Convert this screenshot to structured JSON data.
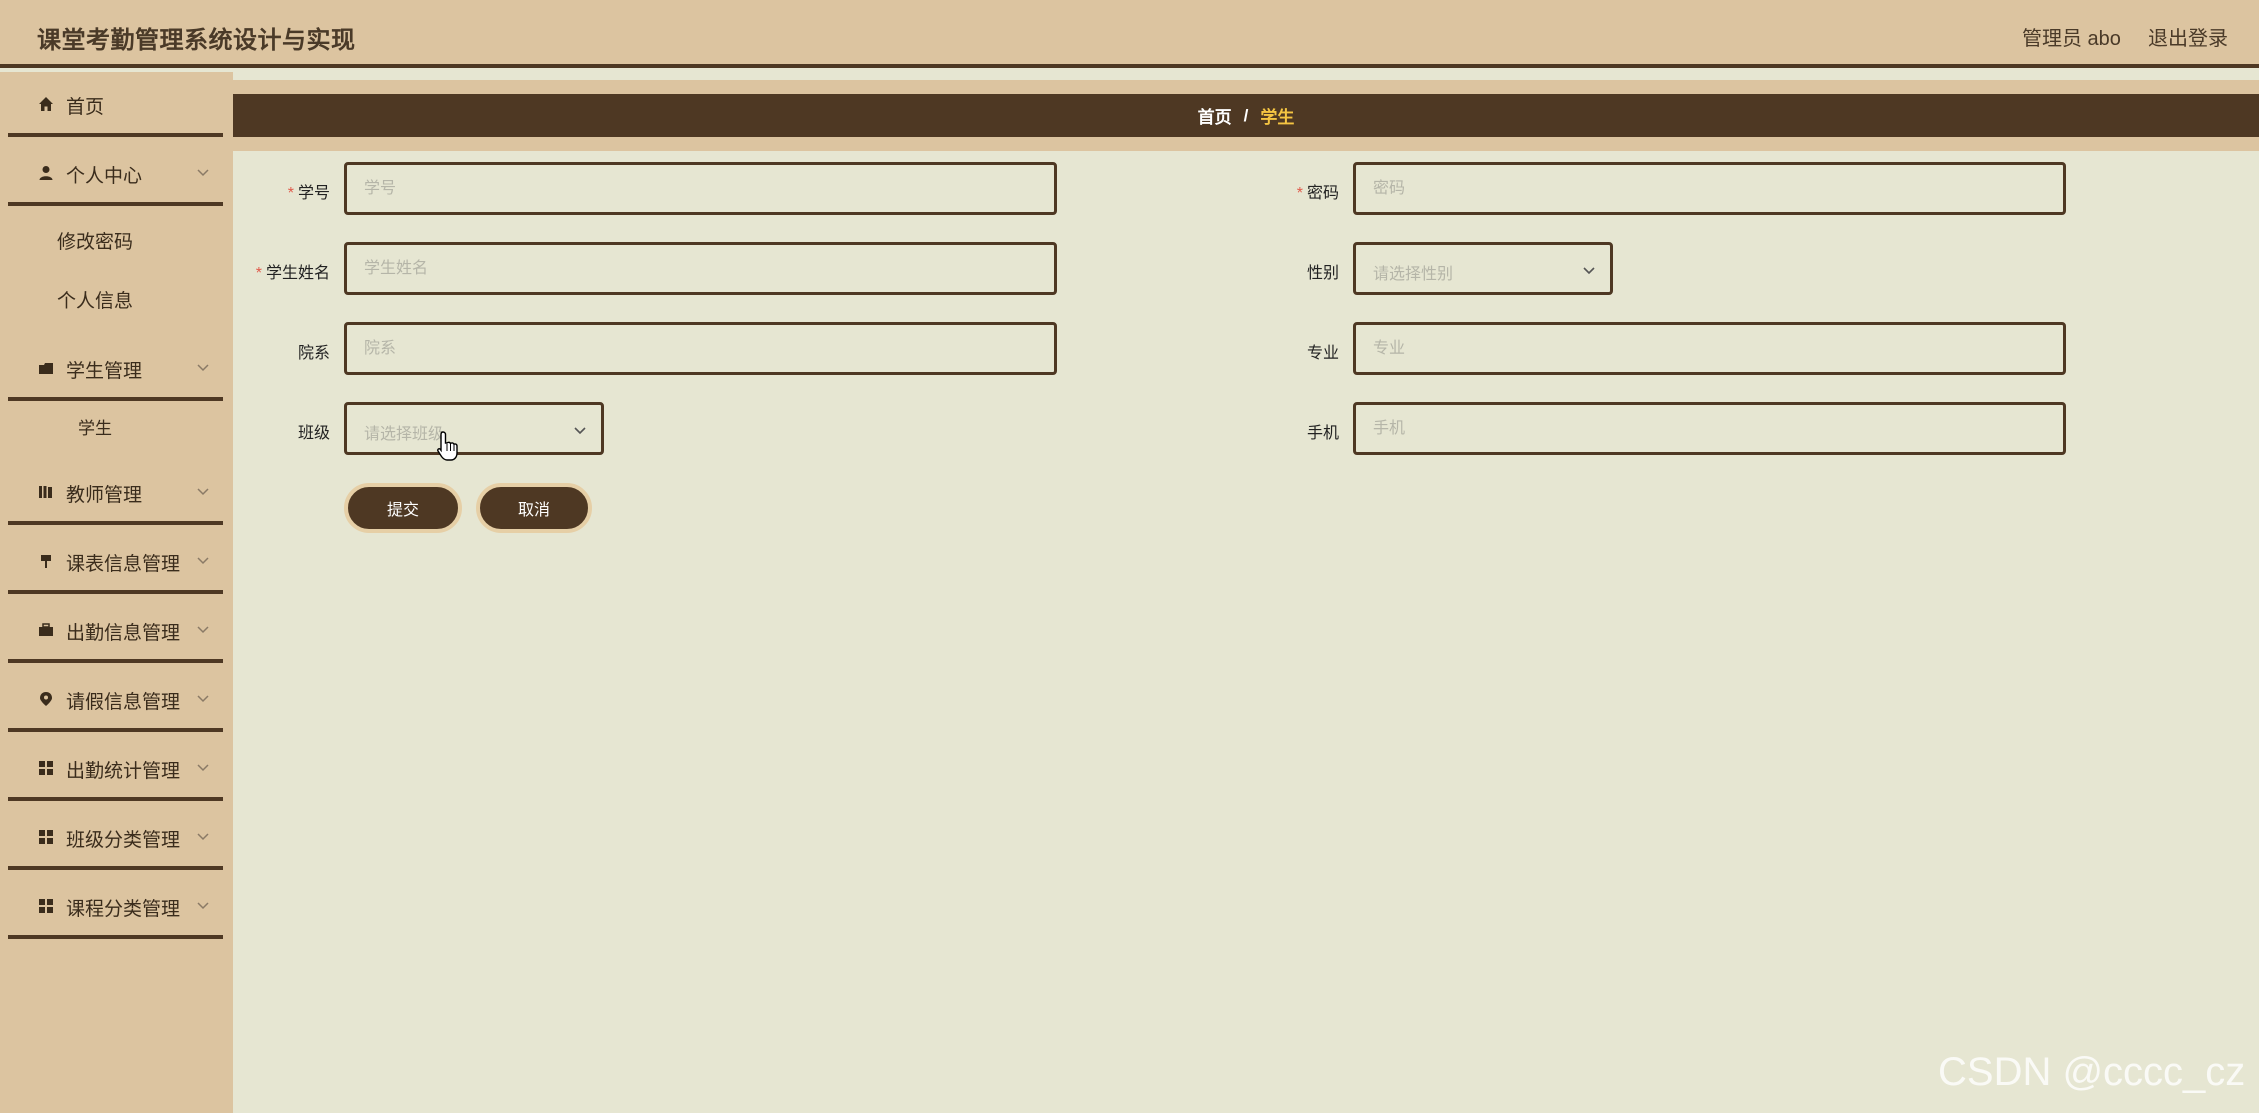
{
  "header": {
    "title": "课堂考勤管理系统设计与实现",
    "user": "管理员 abo",
    "logout": "退出登录"
  },
  "sidebar": {
    "items": [
      {
        "label": "首页",
        "icon": "home-icon"
      },
      {
        "label": "个人中心",
        "icon": "user-icon"
      },
      {
        "label": "学生管理",
        "icon": "folder-icon"
      },
      {
        "label": "教师管理",
        "icon": "book-icon"
      },
      {
        "label": "课表信息管理",
        "icon": "pin-icon"
      },
      {
        "label": "出勤信息管理",
        "icon": "briefcase-icon"
      },
      {
        "label": "请假信息管理",
        "icon": "location-icon"
      },
      {
        "label": "出勤统计管理",
        "icon": "grid-icon"
      },
      {
        "label": "班级分类管理",
        "icon": "grid-icon"
      },
      {
        "label": "课程分类管理",
        "icon": "grid-icon"
      }
    ],
    "sub_personal": [
      "修改密码",
      "个人信息"
    ],
    "sub_student": [
      "学生"
    ]
  },
  "breadcrumb": {
    "home": "首页",
    "separator": "/",
    "current": "学生"
  },
  "form": {
    "student_no": {
      "label": "学号",
      "placeholder": "学号",
      "required": true
    },
    "password": {
      "label": "密码",
      "placeholder": "密码",
      "required": true
    },
    "student_name": {
      "label": "学生姓名",
      "placeholder": "学生姓名",
      "required": true
    },
    "gender": {
      "label": "性别",
      "placeholder": "请选择性别"
    },
    "department": {
      "label": "院系",
      "placeholder": "院系"
    },
    "major": {
      "label": "专业",
      "placeholder": "专业"
    },
    "class": {
      "label": "班级",
      "placeholder": "请选择班级"
    },
    "phone": {
      "label": "手机",
      "placeholder": "手机"
    },
    "required_mark": "*",
    "submit": "提交",
    "cancel": "取消"
  },
  "watermark": "CSDN @cccc_cz",
  "colors": {
    "accent_dark": "#4e3823",
    "sidebar_bg": "#dcc4a0",
    "content_bg": "#e6e6d2",
    "breadcrumb_active": "#f5c542",
    "required": "#e05a4a"
  }
}
